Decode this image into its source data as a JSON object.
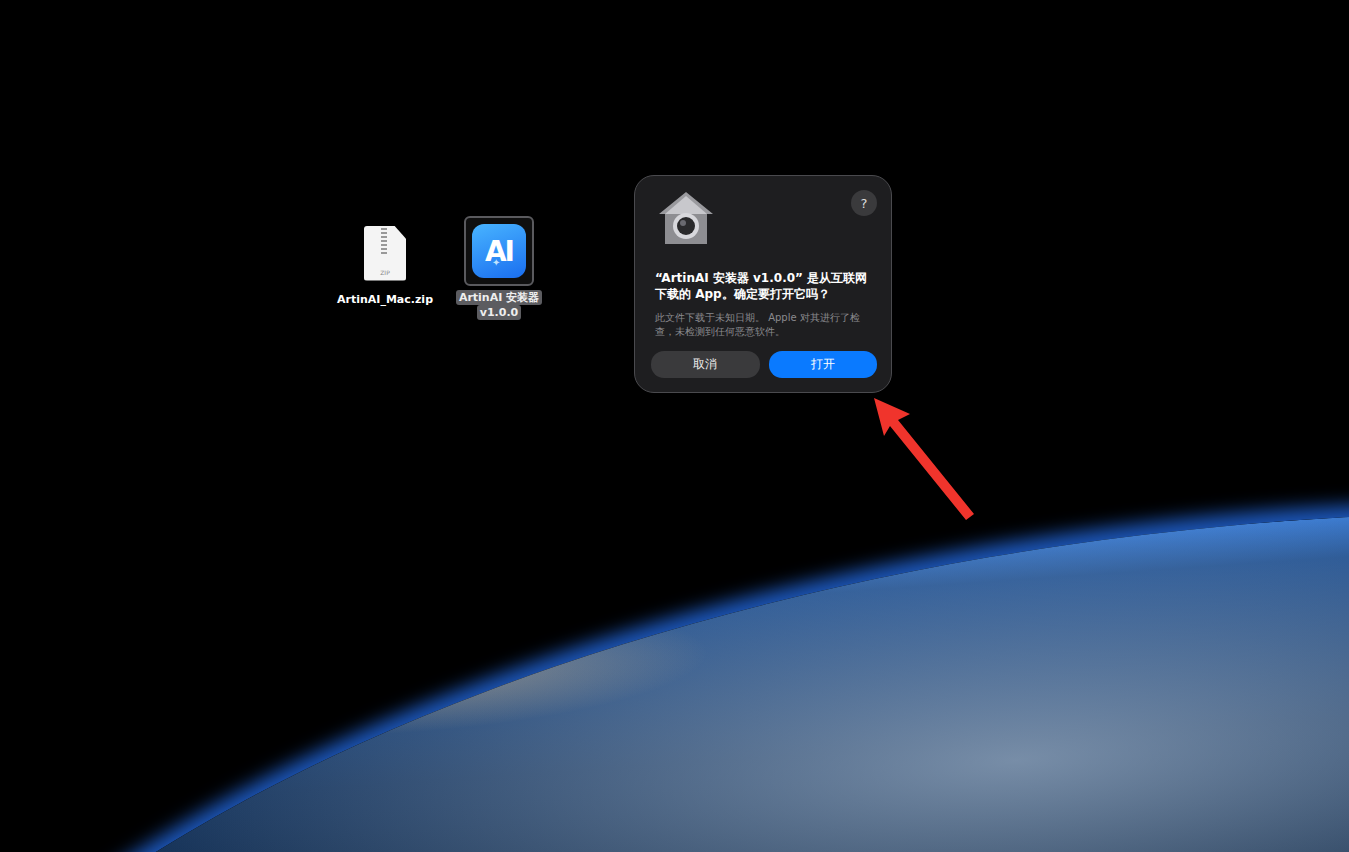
{
  "desktop": {
    "icons": [
      {
        "label": "ArtinAI_Mac.zip",
        "sublabel": "",
        "kind": "zip",
        "badge": "ZIP",
        "selected": false
      },
      {
        "label": "ArtinAI 安装器",
        "sublabel": "v1.0.0",
        "kind": "app",
        "badge": "AI",
        "selected": true
      }
    ]
  },
  "dialog": {
    "help": "?",
    "title": "“ArtinAI 安装器 v1.0.0” 是从互联网下载的 App。确定要打开它吗？",
    "message": "此文件下载于未知日期。 Apple 对其进行了检查，未检测到任何恶意软件。",
    "buttons": [
      {
        "label": "取消",
        "primary": false
      },
      {
        "label": "打开",
        "primary": true
      }
    ]
  }
}
